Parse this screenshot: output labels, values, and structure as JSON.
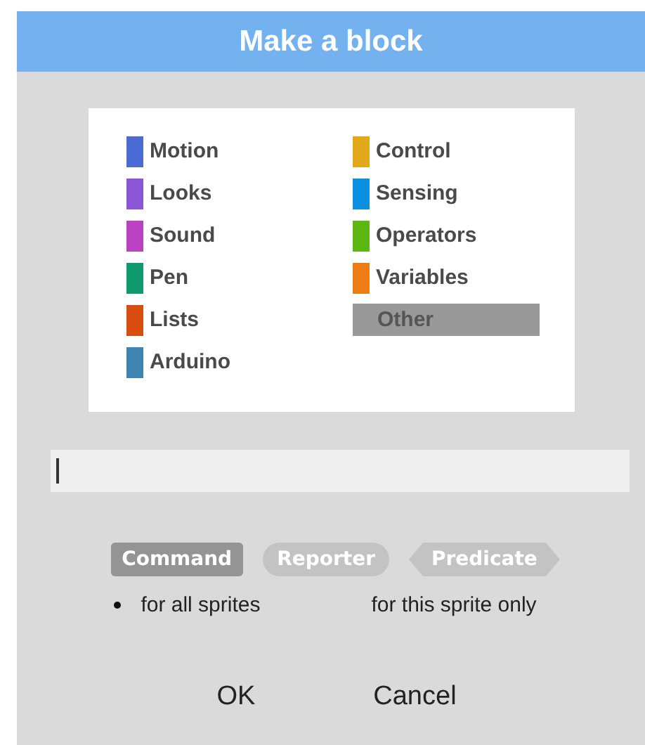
{
  "window": {
    "title": "Make a block"
  },
  "categories": [
    {
      "label": "Motion",
      "color": "#4a6cd4",
      "selected": false
    },
    {
      "label": "Looks",
      "color": "#8a55d7",
      "selected": false
    },
    {
      "label": "Sound",
      "color": "#bb42c3",
      "selected": false
    },
    {
      "label": "Pen",
      "color": "#0e9a6c",
      "selected": false
    },
    {
      "label": "Lists",
      "color": "#d94d11",
      "selected": false
    },
    {
      "label": "Arduino",
      "color": "#3d85b0",
      "selected": false
    },
    {
      "label": "Control",
      "color": "#e1a91a",
      "selected": false
    },
    {
      "label": "Sensing",
      "color": "#0b8fe0",
      "selected": false
    },
    {
      "label": "Operators",
      "color": "#5cb712",
      "selected": false
    },
    {
      "label": "Variables",
      "color": "#ee7d16",
      "selected": false
    },
    {
      "label": "Other",
      "color": "#999999",
      "selected": true
    }
  ],
  "block_types": [
    {
      "label": "Command",
      "kind": "command",
      "selected": true
    },
    {
      "label": "Reporter",
      "kind": "reporter",
      "selected": false
    },
    {
      "label": "Predicate",
      "kind": "predicate",
      "selected": false
    }
  ],
  "scope": [
    {
      "label": "for all sprites",
      "selected": true
    },
    {
      "label": "for this sprite only",
      "selected": false
    }
  ],
  "buttons": [
    "OK",
    "Cancel"
  ]
}
